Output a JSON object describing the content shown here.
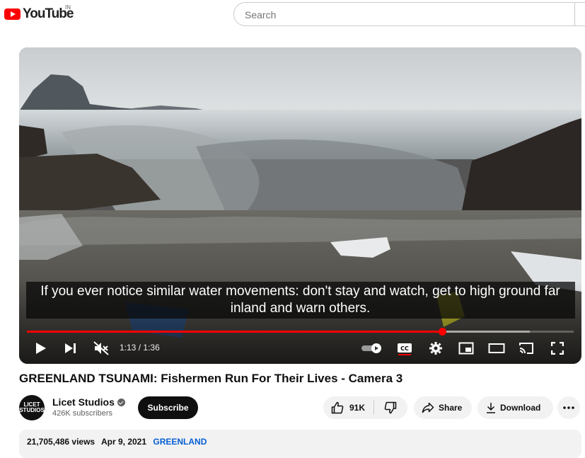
{
  "app": {
    "logo_text": "YouTube",
    "region": "IN"
  },
  "search": {
    "placeholder": "Search"
  },
  "player": {
    "caption": "If you ever notice similar water movements: don't stay and watch, get to high ground far inland and warn others.",
    "time_current": "1:13",
    "time_separator": "/",
    "time_total": "1:36",
    "played_fraction": 0.76,
    "buffered_fraction": 0.92,
    "icons": [
      "play-icon",
      "next-icon",
      "mute-icon",
      "autoplay-toggle-icon",
      "captions-icon",
      "settings-icon",
      "miniplayer-icon",
      "theater-mode-icon",
      "cast-icon",
      "fullscreen-icon"
    ],
    "colors": {
      "progress": "#ff0000"
    }
  },
  "video": {
    "title": "GREENLAND TSUNAMI: Fishermen Run For Their Lives - Camera 3"
  },
  "channel": {
    "avatar_text_1": "LICET",
    "avatar_text_2": "STUDIOS",
    "name": "Licet Studios",
    "subscribers": "426K subscribers",
    "subscribe_label": "Subscribe"
  },
  "actions": {
    "likes": "91K",
    "share_label": "Share",
    "download_label": "Download"
  },
  "description": {
    "views": "21,705,486 views",
    "date": "Apr 9, 2021",
    "hashtag": "GREENLAND"
  }
}
